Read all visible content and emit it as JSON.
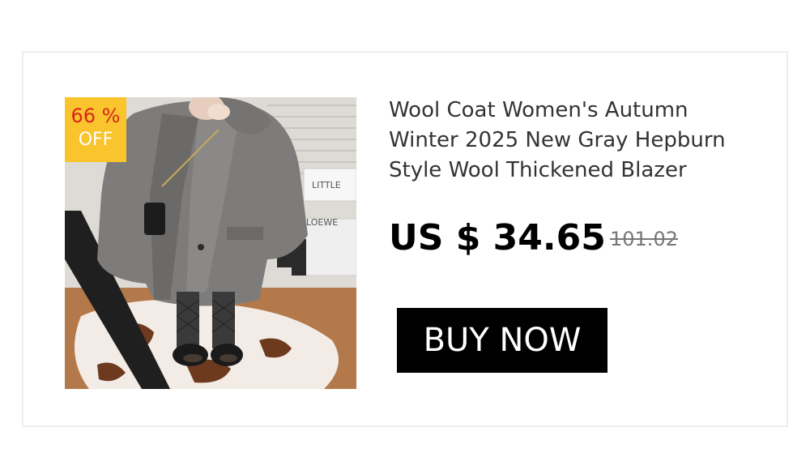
{
  "product": {
    "image_alt": "Wool Coat Women's Autumn Winter 2025 New Gray Hepburn Style Wool Thickened Blazer",
    "photo_signs": [
      "LITTLE",
      "LOEWE"
    ],
    "discount": {
      "percent_label": "66 %",
      "off_label": "OFF"
    },
    "title": "Wool Coat Women's Autumn Winter 2025 New Gray Hepburn Style Wool Thickened Blazer",
    "price": "US $ 34.65",
    "original_price": "101.02",
    "buy_label": "BUY NOW"
  },
  "colors": {
    "badge_bg": "#f9c42c",
    "badge_pct": "#d9261c",
    "button_bg": "#000000",
    "button_text": "#ffffff",
    "title_text": "#333333",
    "old_price_text": "#777777"
  }
}
